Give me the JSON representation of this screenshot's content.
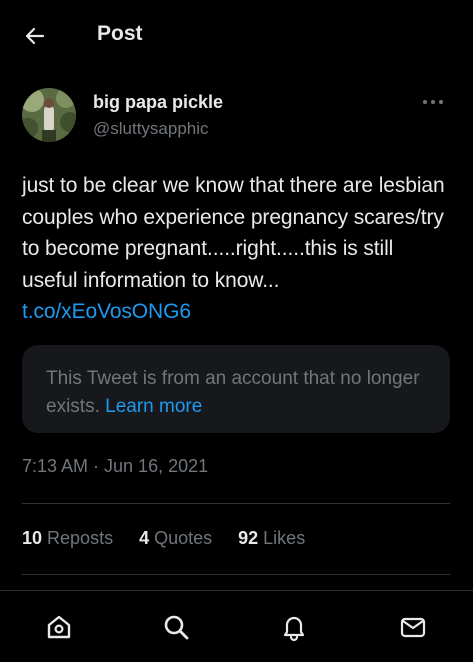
{
  "header": {
    "title": "Post",
    "back_icon": "arrow-left-icon"
  },
  "author": {
    "display_name": "big papa pickle",
    "handle": "@sluttysapphic",
    "more_icon": "more-horizontal-icon"
  },
  "tweet": {
    "text": "just to be clear we know that there are lesbian couples who experience pregnancy scares/try to become pregnant.....right.....this is still useful information to know... ",
    "link": "t.co/xEoVosONG6"
  },
  "quote": {
    "message": "This Tweet is from an account that no longer exists. ",
    "link_label": "Learn more"
  },
  "timestamp": "7:13 AM · Jun 16, 2021",
  "stats": {
    "reposts_count": "10",
    "reposts_label": " Reposts",
    "quotes_count": "4",
    "quotes_label": " Quotes",
    "likes_count": "92",
    "likes_label": " Likes"
  },
  "nav": {
    "home_icon": "home-icon",
    "search_icon": "search-icon",
    "notifications_icon": "bell-icon",
    "messages_icon": "mail-icon"
  },
  "colors": {
    "background": "#000000",
    "text": "#e7e9ea",
    "secondary": "#71767b",
    "accent": "#1d9bf0",
    "card": "#16181c",
    "divider": "#2f3336"
  }
}
